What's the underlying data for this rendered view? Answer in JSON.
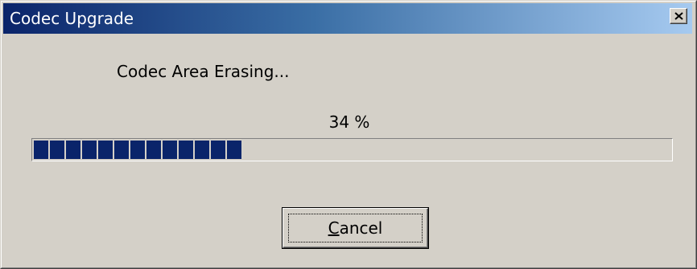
{
  "window": {
    "title": "Codec Upgrade",
    "close_icon": "close-icon"
  },
  "status": {
    "message": "Codec Area Erasing...",
    "percent_label": "34 %",
    "progress_percent": 34
  },
  "buttons": {
    "cancel_label": "Cancel",
    "cancel_mnemonic": "C",
    "cancel_rest": "ancel"
  },
  "colors": {
    "title_gradient_start": "#0a246a",
    "title_gradient_end": "#a6caf0",
    "progress_fill": "#0a246a",
    "dialog_face": "#d4d0c8"
  }
}
